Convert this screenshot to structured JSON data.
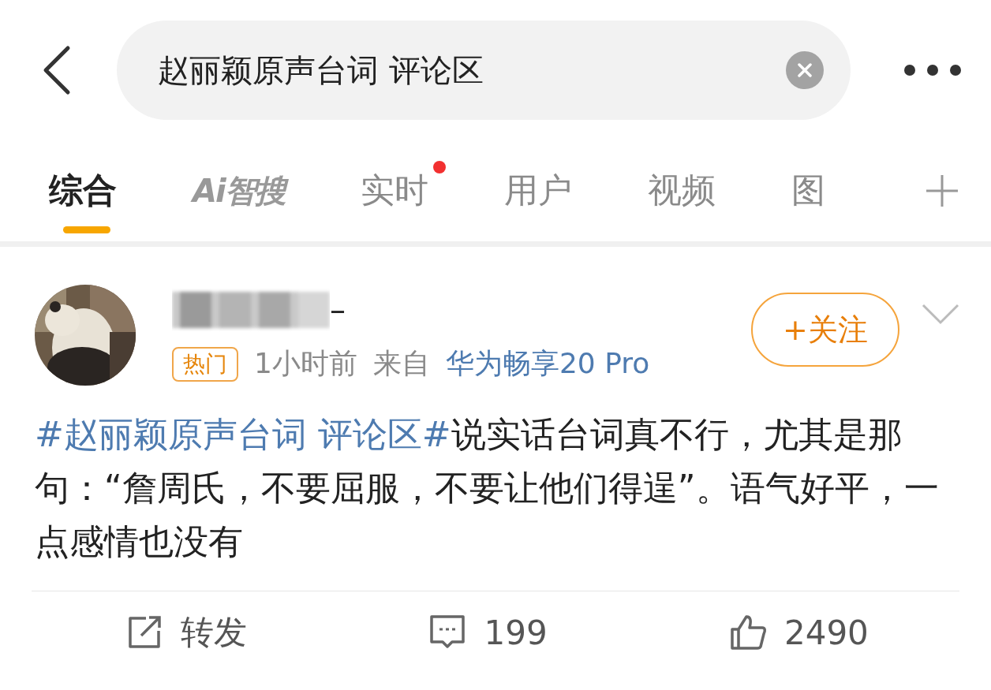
{
  "search": {
    "value": "赵丽颖原声台词 评论区"
  },
  "tabs": [
    {
      "label": "综合",
      "selected": true,
      "kind": "text",
      "unread": false
    },
    {
      "label": "Ai智搜",
      "selected": false,
      "kind": "logo",
      "unread": false
    },
    {
      "label": "实时",
      "selected": false,
      "kind": "text",
      "unread": true
    },
    {
      "label": "用户",
      "selected": false,
      "kind": "text",
      "unread": false
    },
    {
      "label": "视频",
      "selected": false,
      "kind": "text",
      "unread": false
    },
    {
      "label": "图",
      "selected": false,
      "kind": "cut",
      "unread": false
    }
  ],
  "post": {
    "username_tail": "–",
    "badge": "热门",
    "time": "1小时前",
    "source_label": "来自",
    "source": "华为畅享20 Pro",
    "follow": "+关注",
    "topic": "#赵丽颖原声台词 评论区#",
    "text": "说实话台词真不行，尤其是那句：“詹周氏，不要屈服，不要让他们得逞”。语气好平，一点感情也没有",
    "actions": [
      {
        "kind": "repost",
        "label": "转发"
      },
      {
        "kind": "comment",
        "label": "199"
      },
      {
        "kind": "like",
        "label": "2490"
      }
    ]
  }
}
